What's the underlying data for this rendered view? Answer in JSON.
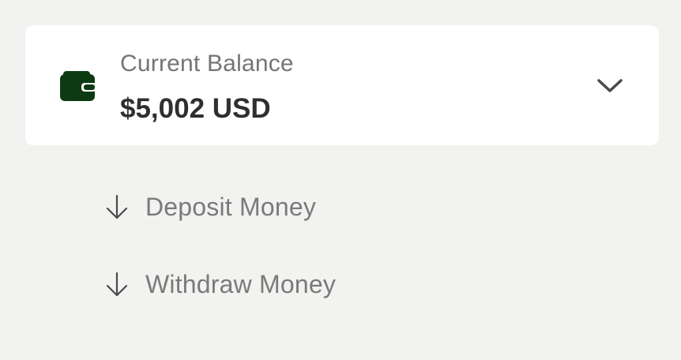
{
  "balance": {
    "label": "Current Balance",
    "amount": "$5,002 USD",
    "icon": "wallet-icon",
    "expand_icon": "chevron-down-icon"
  },
  "actions": [
    {
      "label": "Deposit Money",
      "icon": "arrow-down-icon"
    },
    {
      "label": "Withdraw Money",
      "icon": "arrow-down-icon"
    }
  ],
  "colors": {
    "background": "#f2f3f0",
    "card": "#ffffff",
    "wallet_icon": "#0d3a12",
    "label_text": "#757575",
    "amount_text": "#2f2f2f",
    "action_text": "#7a7a7a"
  }
}
